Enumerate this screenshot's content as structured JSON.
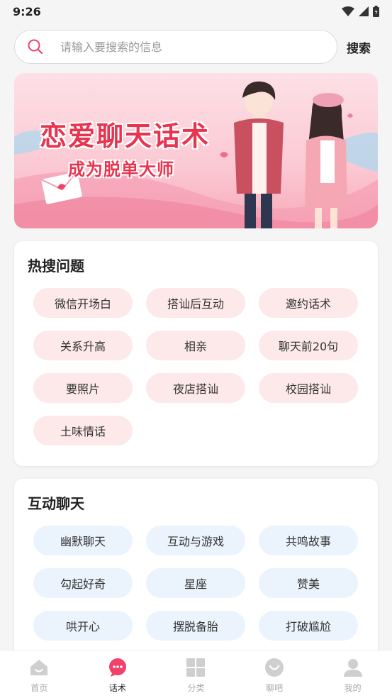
{
  "status_bar": {
    "time": "9:26"
  },
  "search": {
    "placeholder": "请输入要搜索的信息",
    "button_label": "搜索"
  },
  "banner": {
    "title": "恋爱聊天话术",
    "subtitle": "成为脱单大师"
  },
  "hot_section": {
    "title": "热搜问题",
    "tags": [
      "微信开场白",
      "搭讪后互动",
      "邀约话术",
      "关系升高",
      "相亲",
      "聊天前20句",
      "要照片",
      "夜店搭讪",
      "校园搭讪",
      "土味情话"
    ]
  },
  "chat_section": {
    "title": "互动聊天",
    "tags": [
      "幽默聊天",
      "互动与游戏",
      "共鸣故事",
      "勾起好奇",
      "星座",
      "赞美",
      "哄开心",
      "摆脱备胎",
      "打破尴尬"
    ]
  },
  "tab_bar": {
    "active_index": 1,
    "active_color": "#f0426a",
    "inactive_color": "#cfcfcf",
    "items": [
      {
        "label": "首页",
        "icon": "home-icon"
      },
      {
        "label": "话术",
        "icon": "chat-bubble-icon"
      },
      {
        "label": "分类",
        "icon": "grid-icon"
      },
      {
        "label": "聊吧",
        "icon": "smile-icon"
      },
      {
        "label": "我的",
        "icon": "user-icon"
      }
    ]
  }
}
